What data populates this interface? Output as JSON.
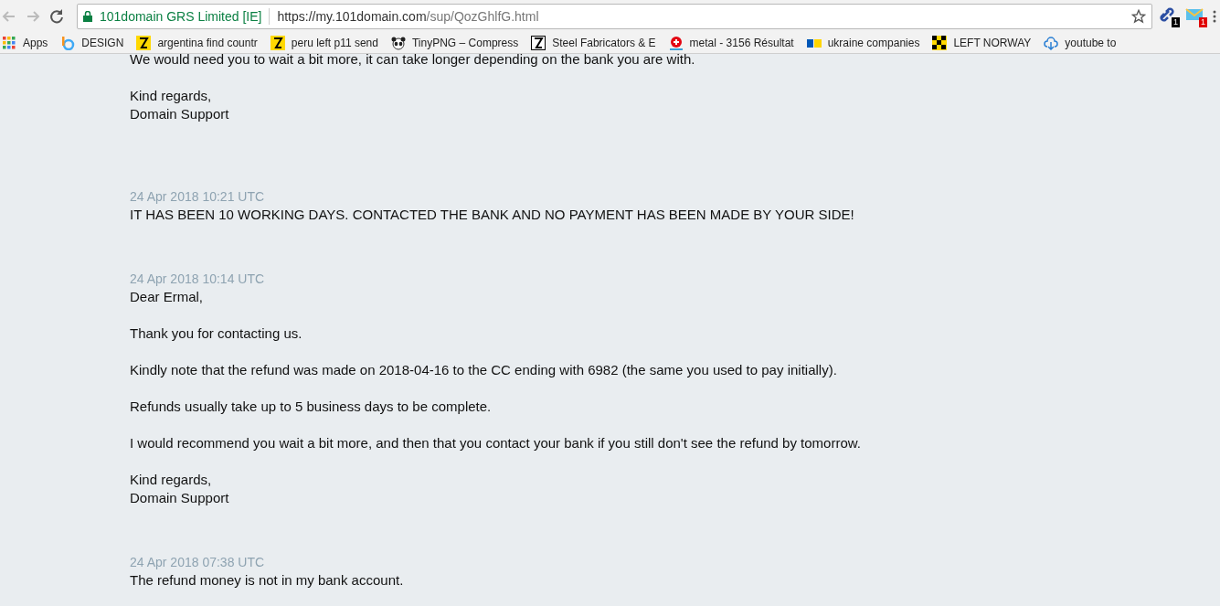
{
  "browser": {
    "site_identity": "101domain GRS Limited [IE]",
    "url_host": "https://my.101domain.com",
    "url_path": "/sup/QozGhlfG.html",
    "extensions": [
      {
        "badge": "1",
        "color": "#000000"
      },
      {
        "badge": "1",
        "color": "#e00000"
      }
    ]
  },
  "bookmarks": [
    {
      "label": "Apps",
      "kind": "apps"
    },
    {
      "label": "DESIGN",
      "kind": "ring"
    },
    {
      "label": "argentina find countr",
      "kind": "yellow"
    },
    {
      "label": "peru left p11 send",
      "kind": "yellow"
    },
    {
      "label": "TinyPNG – Compress",
      "kind": "panda"
    },
    {
      "label": "Steel Fabricators & E",
      "kind": "yellow-box"
    },
    {
      "label": "metal - 3156 Résultat",
      "kind": "red"
    },
    {
      "label": "ukraine companies",
      "kind": "ua"
    },
    {
      "label": "LEFT NORWAY",
      "kind": "checker"
    },
    {
      "label": "youtube to",
      "kind": "cloud"
    }
  ],
  "messages": [
    {
      "paragraphs": [
        "We would need you to wait a bit more, it can take longer depending on the bank you are with.",
        "Kind regards,\nDomain Support"
      ]
    },
    {
      "timestamp": "24 Apr 2018 10:21 UTC",
      "paragraphs": [
        "IT HAS BEEN 10 WORKING DAYS. CONTACTED THE BANK AND NO PAYMENT HAS BEEN MADE BY YOUR SIDE!"
      ]
    },
    {
      "timestamp": "24 Apr 2018 10:14 UTC",
      "paragraphs": [
        "Dear Ermal,",
        "Thank you for contacting us.",
        "Kindly note that the refund was made on 2018-04-16 to the CC ending with 6982 (the same you used to pay initially).",
        "Refunds usually take up to 5 business days to be complete.",
        "I would recommend you wait a bit more, and then that you contact your bank if you still don't see the refund by tomorrow.",
        "Kind regards,\nDomain Support"
      ]
    },
    {
      "timestamp": "24 Apr 2018 07:38 UTC",
      "paragraphs": [
        "The refund money is not in my bank account."
      ]
    }
  ]
}
